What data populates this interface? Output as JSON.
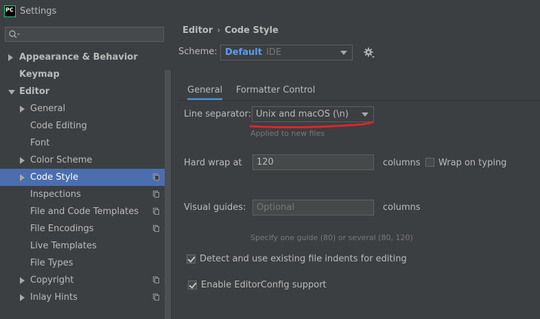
{
  "window": {
    "title": "Settings",
    "logo_text": "PC"
  },
  "sidebar": {
    "search_placeholder": "",
    "items": [
      {
        "label": "Appearance & Behavior",
        "level": 0,
        "arrow": "right",
        "bold": true
      },
      {
        "label": "Keymap",
        "level": 0,
        "arrow": "none",
        "bold": true
      },
      {
        "label": "Editor",
        "level": 0,
        "arrow": "down",
        "bold": true
      },
      {
        "label": "General",
        "level": 1,
        "arrow": "right"
      },
      {
        "label": "Code Editing",
        "level": 1,
        "arrow": "none"
      },
      {
        "label": "Font",
        "level": 1,
        "arrow": "none"
      },
      {
        "label": "Color Scheme",
        "level": 1,
        "arrow": "right"
      },
      {
        "label": "Code Style",
        "level": 1,
        "arrow": "right",
        "selected": true,
        "copy_icon": true
      },
      {
        "label": "Inspections",
        "level": 1,
        "arrow": "none",
        "copy_icon": true
      },
      {
        "label": "File and Code Templates",
        "level": 1,
        "arrow": "none",
        "copy_icon": true
      },
      {
        "label": "File Encodings",
        "level": 1,
        "arrow": "none",
        "copy_icon": true
      },
      {
        "label": "Live Templates",
        "level": 1,
        "arrow": "none"
      },
      {
        "label": "File Types",
        "level": 1,
        "arrow": "none"
      },
      {
        "label": "Copyright",
        "level": 1,
        "arrow": "right",
        "copy_icon": true
      },
      {
        "label": "Inlay Hints",
        "level": 1,
        "arrow": "right",
        "copy_icon": true
      }
    ]
  },
  "breadcrumb": {
    "parent": "Editor",
    "separator": "›",
    "current": "Code Style"
  },
  "scheme": {
    "label": "Scheme:",
    "name": "Default",
    "type": "IDE"
  },
  "tabs": [
    {
      "label": "General",
      "active": true
    },
    {
      "label": "Formatter Control",
      "active": false
    }
  ],
  "general": {
    "line_separator": {
      "label": "Line separator:",
      "value": "Unix and macOS (\\n)",
      "hint": "Applied to new files"
    },
    "hard_wrap": {
      "label": "Hard wrap at",
      "value": "120",
      "unit": "columns",
      "wrap_on_typing_label": "Wrap on typing",
      "wrap_on_typing_checked": false
    },
    "visual_guides": {
      "label": "Visual guides:",
      "placeholder": "Optional",
      "unit": "columns",
      "hint": "Specify one guide (80) or several (80, 120)"
    },
    "detect_indents": {
      "label": "Detect and use existing file indents for editing",
      "checked": true
    },
    "editorconfig": {
      "label": "Enable EditorConfig support",
      "checked": true
    }
  },
  "colors": {
    "accent": "#4b6eaf",
    "scheme_name": "#589df6",
    "annotation": "#e0242e"
  }
}
